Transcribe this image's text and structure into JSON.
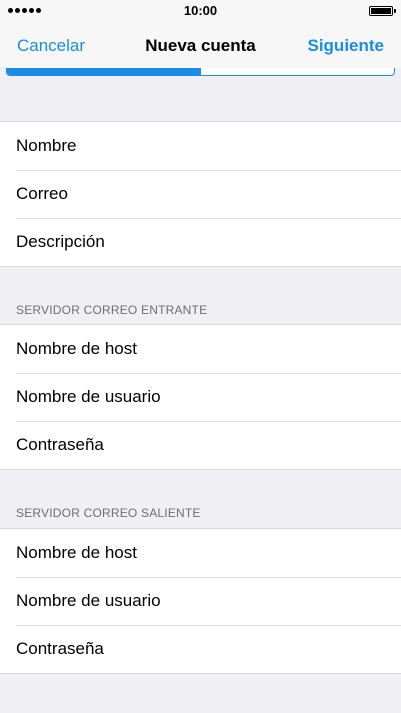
{
  "status_bar": {
    "time": "10:00",
    "signal_dots": 5,
    "battery_level": 1.0
  },
  "nav": {
    "cancel_label": "Cancelar",
    "title": "Nueva cuenta",
    "next_label": "Siguiente"
  },
  "progress": {
    "fraction": 0.5
  },
  "account_fields": [
    {
      "label": "Nombre"
    },
    {
      "label": "Correo"
    },
    {
      "label": "Descripción"
    }
  ],
  "incoming": {
    "header": "SERVIDOR CORREO ENTRANTE",
    "fields": [
      {
        "label": "Nombre de host"
      },
      {
        "label": "Nombre de usuario"
      },
      {
        "label": "Contraseña"
      }
    ]
  },
  "outgoing": {
    "header": "SERVIDOR CORREO SALIENTE",
    "fields": [
      {
        "label": "Nombre de host"
      },
      {
        "label": "Nombre de usuario"
      },
      {
        "label": "Contraseña"
      }
    ]
  },
  "colors": {
    "accent": "#1a8ce6",
    "background": "#efeff4",
    "section_header": "#6d6d72"
  }
}
